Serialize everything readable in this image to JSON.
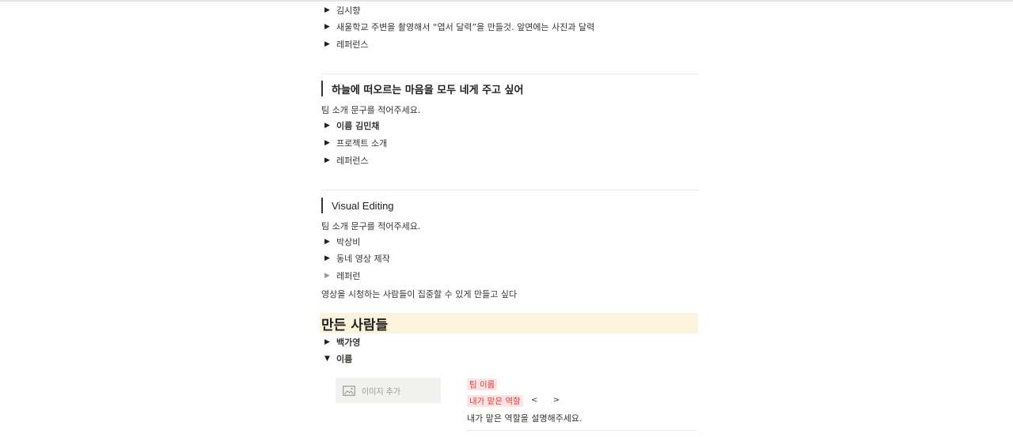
{
  "section1": {
    "items": [
      {
        "label": "김시향",
        "expanded": false
      },
      {
        "label": "새울학교 주변을 촬영해서 “엽서 달력”을 만들것. 앞면에는 사진과 달력",
        "expanded": false
      },
      {
        "label": "레퍼런스",
        "expanded": false
      }
    ]
  },
  "section2": {
    "title": "하늘에 떠오르는 마음을 모두 네게 주고 싶어",
    "intro": "팀 소개 문구를 적어주세요.",
    "items": [
      {
        "label": "이름 김민채",
        "expanded": false
      },
      {
        "label": "프로젝트 소개",
        "expanded": false
      },
      {
        "label": "레퍼런스",
        "expanded": false
      }
    ]
  },
  "section3": {
    "title": "Visual Editing",
    "intro": "팀 소개 문구를 적어주세요.",
    "items": [
      {
        "label": "박상비",
        "expanded": false
      },
      {
        "label": "동네 영상 제작",
        "expanded": false
      },
      {
        "label": "레퍼런",
        "expanded": false
      }
    ],
    "note": "영상을 시청하는 사람들이 집중할 수 있게 만들고 싶다"
  },
  "makers": {
    "heading": "만든 사람들",
    "heading_bg": "#fbf3db",
    "items": [
      {
        "label": "백가영",
        "expanded": false
      },
      {
        "label": "이름",
        "expanded": true
      }
    ],
    "card": {
      "image_placeholder": "이미지 추가",
      "team_name": "팀 이름",
      "role_label": "내가 맡은 역할",
      "prev_arrow": "<",
      "next_arrow": ">",
      "role_desc": "내가 맡은 역할을 설명해주세요."
    }
  },
  "colors": {
    "tag_bg": "#fbe4e4",
    "tag_text": "#e03e3e"
  }
}
